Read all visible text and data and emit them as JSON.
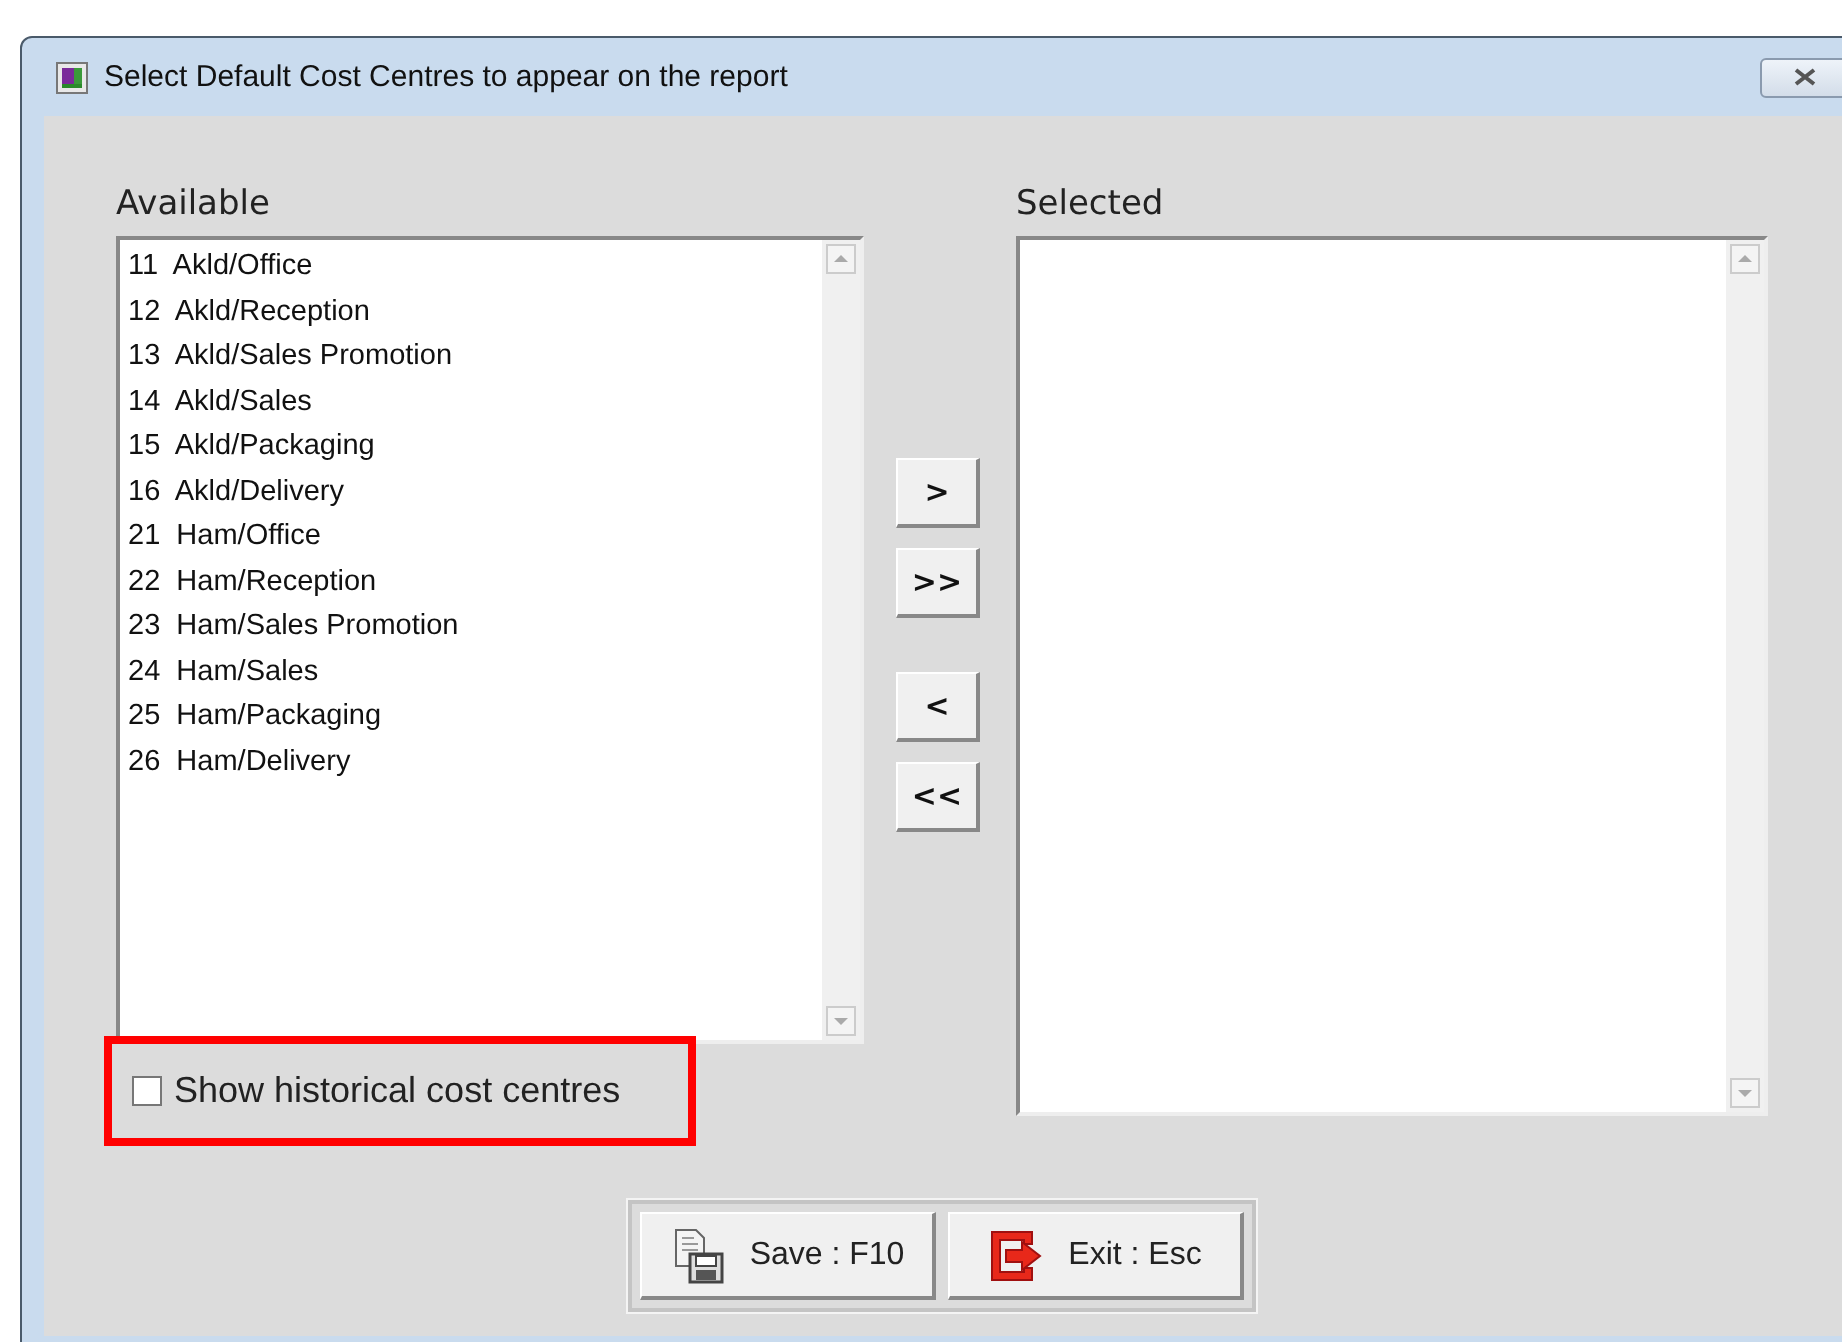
{
  "window": {
    "title": "Select Default Cost Centres to appear on the report"
  },
  "available": {
    "label": "Available",
    "items": [
      "11  Akld/Office",
      "12  Akld/Reception",
      "13  Akld/Sales Promotion",
      "14  Akld/Sales",
      "15  Akld/Packaging",
      "16  Akld/Delivery",
      "21  Ham/Office",
      "22  Ham/Reception",
      "23  Ham/Sales Promotion",
      "24  Ham/Sales",
      "25  Ham/Packaging",
      "26  Ham/Delivery"
    ]
  },
  "move_buttons": [
    {
      "label": ">",
      "kind": "add"
    },
    {
      "label": ">>",
      "kind": "add"
    },
    {
      "label": "<",
      "kind": "remove"
    },
    {
      "label": "<<",
      "kind": "remove"
    }
  ],
  "selected": {
    "label": "Selected"
  },
  "historical_checkbox": {
    "label": "Show historical cost centres",
    "checked": false
  },
  "footer_buttons": [
    {
      "label": "Save : F10",
      "kind": "save"
    },
    {
      "label": "Exit : Esc",
      "kind": "exit"
    }
  ]
}
